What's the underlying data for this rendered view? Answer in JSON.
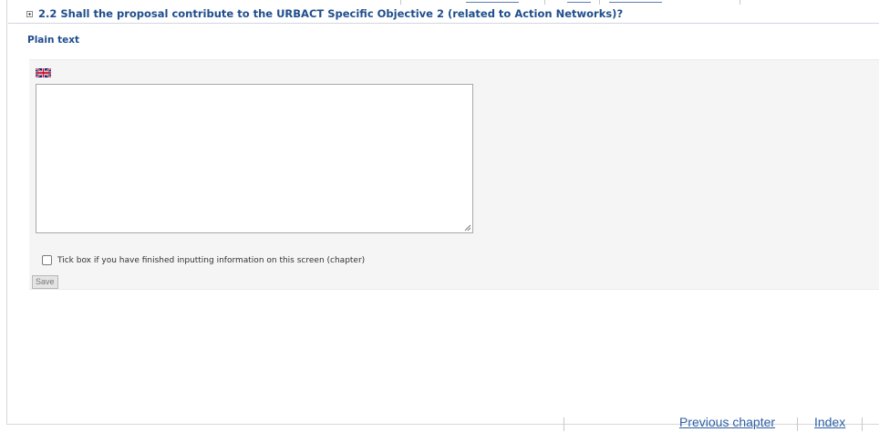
{
  "question": {
    "title": "2.2 Shall the proposal contribute to the URBACT Specific Objective 2 (related to Action Networks)?",
    "format_label": "Plain text"
  },
  "answer": {
    "language_icon": "uk-flag-icon",
    "value": ""
  },
  "finished_checkbox": {
    "label": "Tick box if you have finished inputting information on this screen (chapter)",
    "checked": false
  },
  "save_label": "Save",
  "footer": {
    "previous_chapter": "Previous chapter",
    "index": "Index"
  },
  "colors": {
    "heading_blue": "#1f4e8c",
    "link_blue": "#2e5fa5",
    "panel_bg": "#f5f5f5"
  }
}
